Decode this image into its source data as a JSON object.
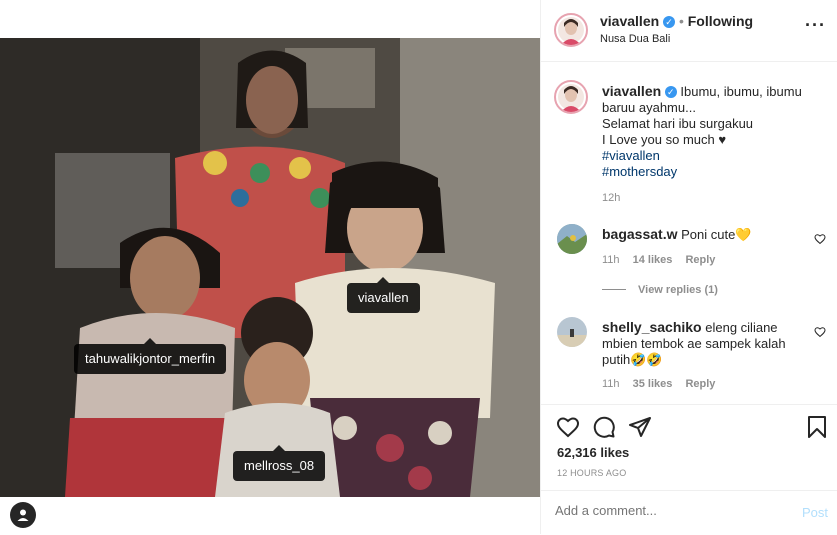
{
  "post": {
    "tags": [
      {
        "username": "viavallen"
      },
      {
        "username": "tahuwalikjontor_merfin"
      },
      {
        "username": "mellross_08"
      }
    ]
  },
  "header": {
    "username": "viavallen",
    "separator": "•",
    "follow_status": "Following",
    "location": "Nusa Dua Bali",
    "more_icon": "more-dots-icon"
  },
  "caption": {
    "username": "viavallen",
    "line1": "Ibumu, ibumu, ibumu",
    "line2": "baruu ayahmu...",
    "line3": "Selamat hari ibu surgakuu",
    "line4": "I Love you so much ♥",
    "hashtag1": "#viavallen",
    "hashtag2": "#mothersday",
    "time": "12h"
  },
  "comments": [
    {
      "username": "bagassat.w",
      "text": "Poni cute💛",
      "time": "11h",
      "likes": "14 likes",
      "reply": "Reply"
    },
    {
      "username": "shelly_sachiko",
      "text": "eleng ciliane mbien tembok ae sampek kalah putih🤣🤣",
      "time": "11h",
      "likes": "35 likes",
      "reply": "Reply"
    }
  ],
  "view_replies": "View replies (1)",
  "actions": {
    "likes_count": "62,316 likes",
    "posted": "12 HOURS AGO"
  },
  "add_comment": {
    "placeholder": "Add a comment...",
    "post_label": "Post"
  },
  "colors": {
    "verified": "#3897f0",
    "link": "#00376b",
    "post_disabled": "#b2dffc",
    "muted": "#8e8e8e"
  }
}
